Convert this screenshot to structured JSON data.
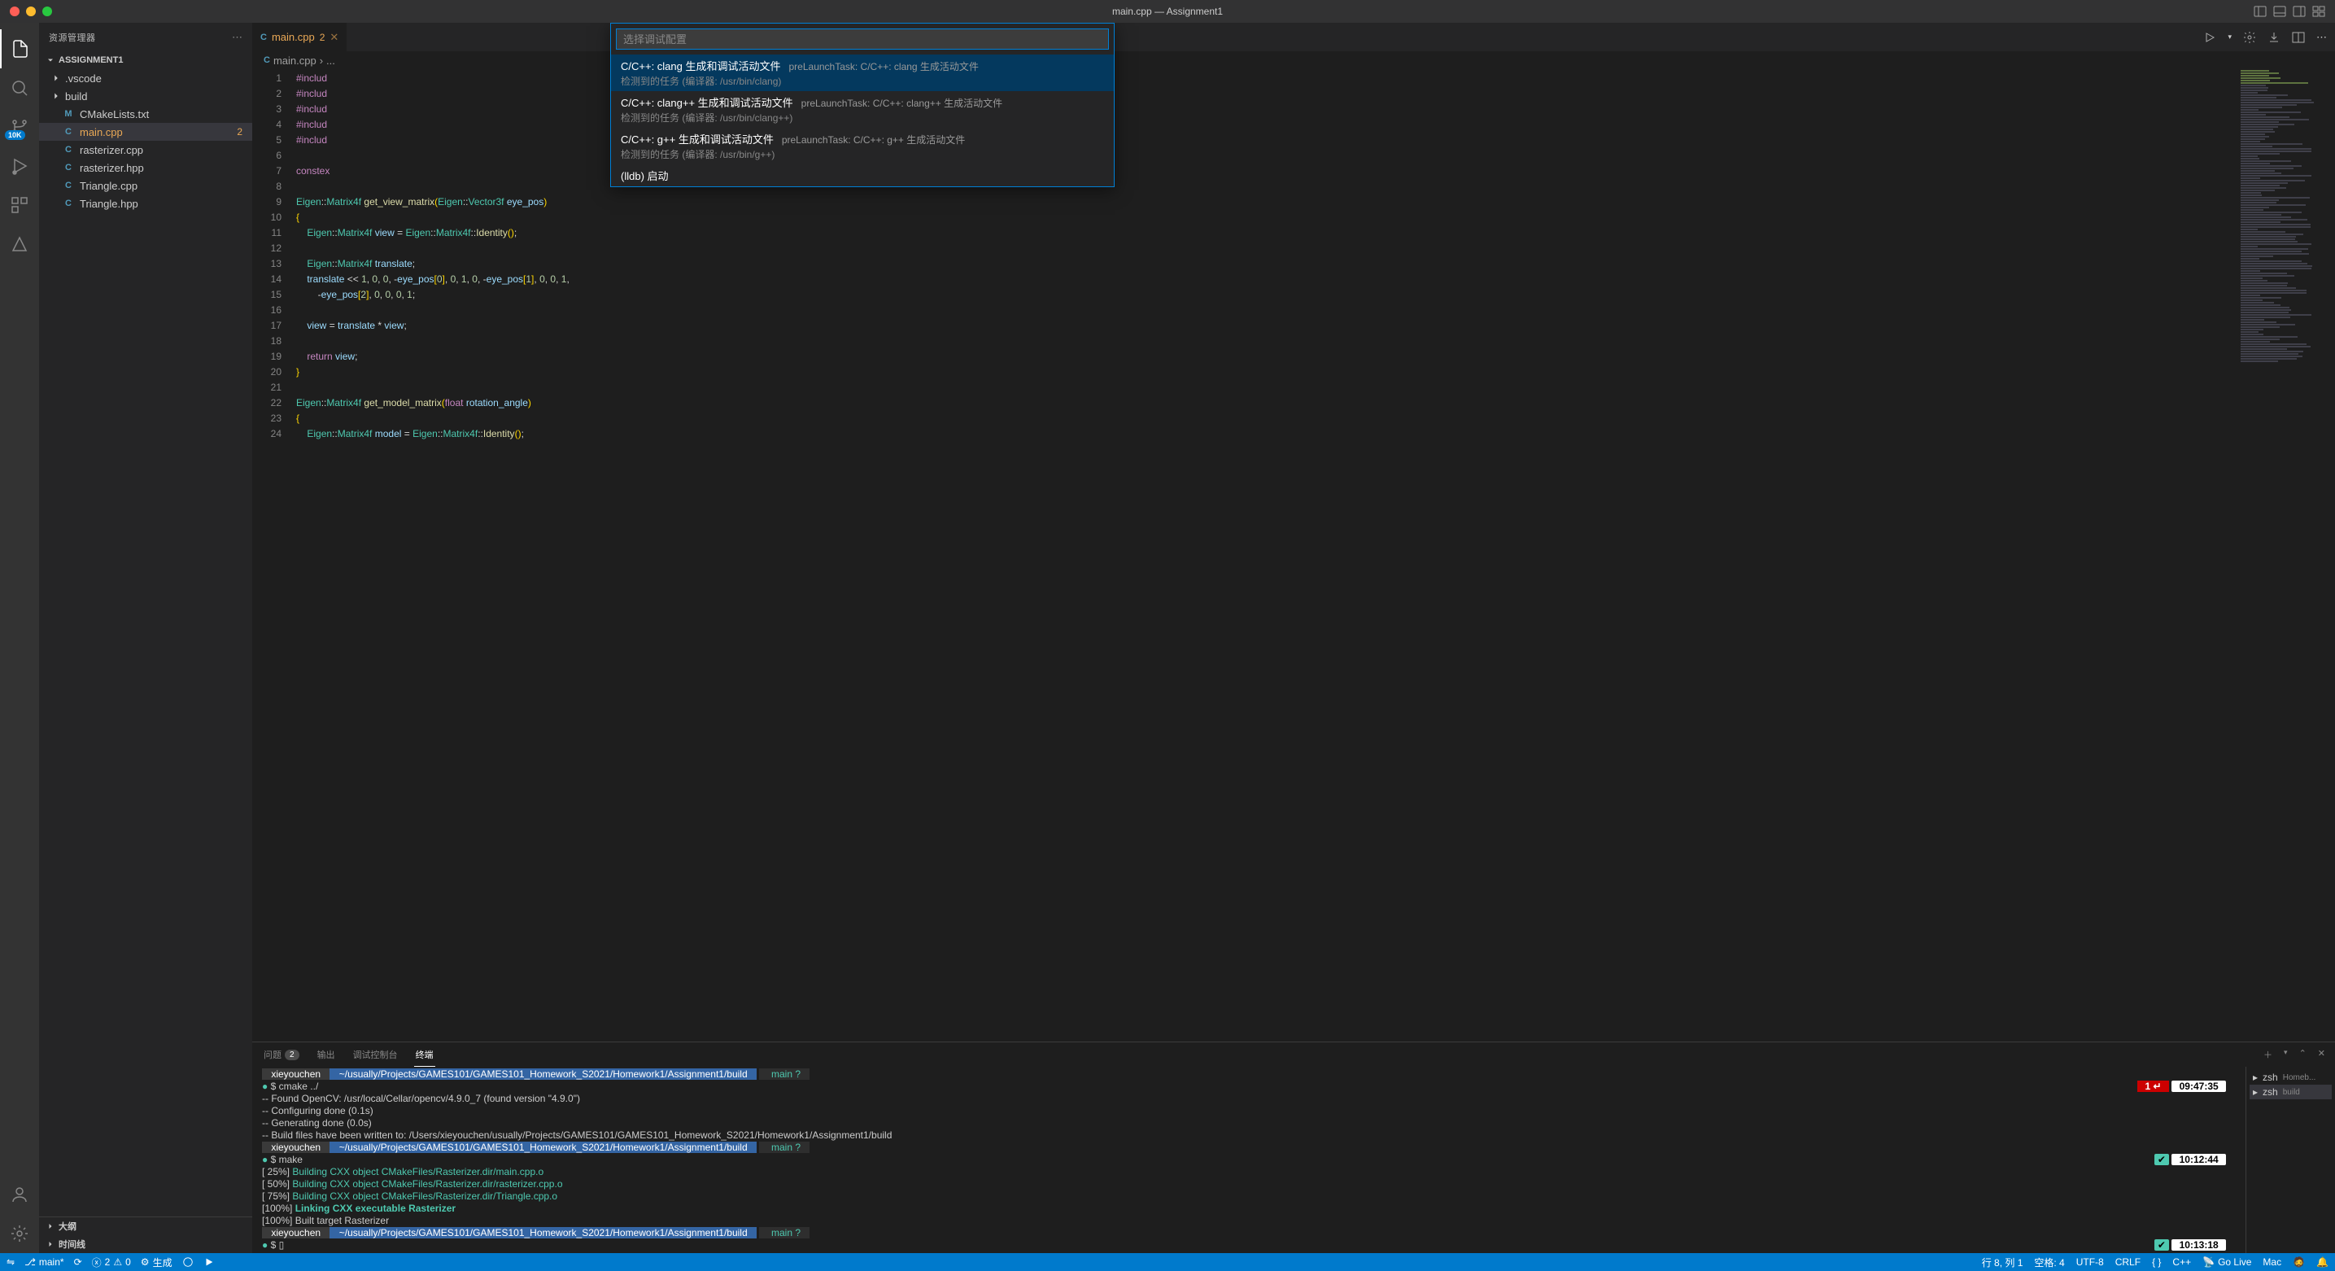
{
  "titlebar": {
    "title": "main.cpp — Assignment1"
  },
  "sidebar": {
    "header": "资源管理器",
    "folder": "ASSIGNMENT1",
    "tree": [
      {
        "name": ".vscode",
        "type": "folder"
      },
      {
        "name": "build",
        "type": "folder"
      },
      {
        "name": "CMakeLists.txt",
        "type": "file",
        "icon": "M"
      },
      {
        "name": "main.cpp",
        "type": "file",
        "icon": "C",
        "warn": true,
        "badge": "2",
        "selected": true
      },
      {
        "name": "rasterizer.cpp",
        "type": "file",
        "icon": "C"
      },
      {
        "name": "rasterizer.hpp",
        "type": "file",
        "icon": "C"
      },
      {
        "name": "Triangle.cpp",
        "type": "file",
        "icon": "C"
      },
      {
        "name": "Triangle.hpp",
        "type": "file",
        "icon": "C"
      }
    ],
    "sections": {
      "outline": "大纲",
      "timeline": "时间线"
    }
  },
  "tabs": {
    "items": [
      {
        "name": "main.cpp",
        "badge": "2",
        "warn": true
      }
    ]
  },
  "breadcrumbs": {
    "segments": [
      "main.cpp",
      "..."
    ]
  },
  "quickpick": {
    "placeholder": "选择调试配置",
    "items": [
      {
        "title": "C/C++: clang 生成和调试活动文件",
        "desc": "preLaunchTask: C/C++: clang 生成活动文件",
        "detail": "检测到的任务 (编译器: /usr/bin/clang)",
        "selected": true
      },
      {
        "title": "C/C++: clang++ 生成和调试活动文件",
        "desc": "preLaunchTask: C/C++: clang++ 生成活动文件",
        "detail": "检测到的任务 (编译器: /usr/bin/clang++)"
      },
      {
        "title": "C/C++: g++ 生成和调试活动文件",
        "desc": "preLaunchTask: C/C++: g++ 生成活动文件",
        "detail": "检测到的任务 (编译器: /usr/bin/g++)"
      },
      {
        "title": "(lldb) 启动",
        "desc": "",
        "detail": ""
      }
    ]
  },
  "editor": {
    "first_line": 1,
    "lines": [
      "#includ",
      "#includ",
      "#includ",
      "#includ",
      "#includ",
      "",
      "constex",
      "",
      "Eigen::Matrix4f get_view_matrix(Eigen::Vector3f eye_pos)",
      "{",
      "    Eigen::Matrix4f view = Eigen::Matrix4f::Identity();",
      "",
      "    Eigen::Matrix4f translate;",
      "    translate << 1, 0, 0, -eye_pos[0], 0, 1, 0, -eye_pos[1], 0, 0, 1,",
      "        -eye_pos[2], 0, 0, 0, 1;",
      "",
      "    view = translate * view;",
      "",
      "    return view;",
      "}",
      "",
      "Eigen::Matrix4f get_model_matrix(float rotation_angle)",
      "{",
      "    Eigen::Matrix4f model = Eigen::Matrix4f::Identity();"
    ]
  },
  "panel": {
    "tabs": {
      "problems": "问题",
      "problems_count": "2",
      "output": "输出",
      "debug_console": "调试控制台",
      "terminal": "终端"
    },
    "terminal_sidebar": [
      {
        "shell": "zsh",
        "label": "Homeb..."
      },
      {
        "shell": "zsh",
        "label": "build",
        "active": true
      }
    ],
    "terminal": {
      "user": "xieyouchen",
      "path": "~/usually/Projects/GAMES101/GAMES101_Homework_S2021/Homework1/Assignment1/build",
      "branch": "main ?",
      "cmd1": "$ cmake ../",
      "time1": "09:47:35",
      "err1": "1 ↵",
      "out1": "-- Found OpenCV: /usr/local/Cellar/opencv/4.9.0_7 (found version \"4.9.0\")",
      "out2": "-- Configuring done (0.1s)",
      "out3": "-- Generating done (0.0s)",
      "out4": "-- Build files have been written to: /Users/xieyouchen/usually/Projects/GAMES101/GAMES101_Homework_S2021/Homework1/Assignment1/build",
      "cmd2": "$ make",
      "time2": "10:12:44",
      "b1": "[ 25%] Building CXX object CMakeFiles/Rasterizer.dir/main.cpp.o",
      "b2": "[ 50%] Building CXX object CMakeFiles/Rasterizer.dir/rasterizer.cpp.o",
      "b3": "[ 75%] Building CXX object CMakeFiles/Rasterizer.dir/Triangle.cpp.o",
      "b4": "[100%] Linking CXX executable Rasterizer",
      "b5": "[100%] Built target Rasterizer",
      "time3": "10:13:18",
      "cmd3": "$ "
    }
  },
  "statusbar": {
    "branch": "main*",
    "sync": "⟳",
    "errors": "2",
    "warnings": "0",
    "build": "生成",
    "cursor": "行 8, 列 1",
    "spaces": "空格: 4",
    "encoding": "UTF-8",
    "eol": "CRLF",
    "lang_braces": "{ }",
    "lang": "C++",
    "golive": "Go Live",
    "os": "Mac"
  },
  "activity": {
    "badge_10k": "10K"
  }
}
